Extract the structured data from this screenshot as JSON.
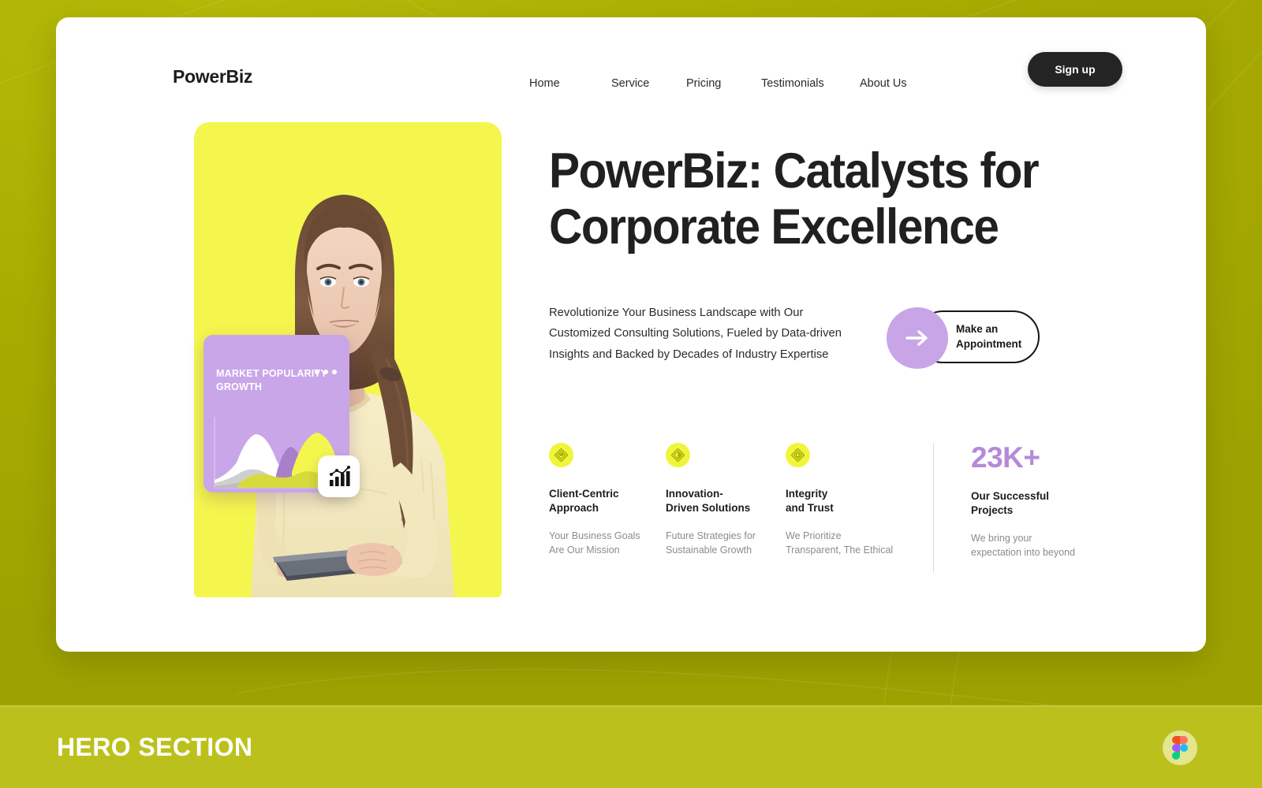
{
  "page": {
    "background_color": "#a9ad00",
    "card_background": "#ffffff"
  },
  "navbar": {
    "brand": "PowerBiz",
    "links": [
      {
        "label": "Home"
      },
      {
        "label": "Service"
      },
      {
        "label": "Pricing"
      },
      {
        "label": "Testimonials"
      },
      {
        "label": "About Us"
      }
    ],
    "signup_label": "Sign up",
    "signup_color": "#242424"
  },
  "hero": {
    "headline": "PowerBiz: Catalysts for\nCorporate Excellence",
    "subtext": "Revolutionize Your Business Landscape with Our\nCustomized Consulting Solutions, Fueled by Data-driven\nInsights and Backed by Decades of Industry Expertise",
    "cta_label": "Make an\nAppointment",
    "cta_circle_color": "#c8a5e6",
    "arrow_icon": "arrow-right-icon"
  },
  "visual": {
    "photo_background": "#f4f64e",
    "market_card": {
      "title": "MARKET\nPOPULARITY\nGROWTH",
      "background": "#c9a6e8",
      "menu_icon": "three-dots-icon"
    },
    "chart_badge_icon": "bar-chart-trend-icon"
  },
  "features": [
    {
      "icon": "diamond-badge-icon",
      "title": "Client-Centric\nApproach",
      "description": "Your Business Goals\nAre Our Mission"
    },
    {
      "icon": "diamond-badge-icon",
      "title": "Innovation-\nDriven Solutions",
      "description": "Future Strategies for\nSustainable Growth"
    },
    {
      "icon": "diamond-badge-icon",
      "title": "Integrity\nand Trust",
      "description": "We Prioritize\nTransparent, The Ethical"
    }
  ],
  "stat": {
    "number": "23K+",
    "number_color": "#b58ad8",
    "title": "Our Successful\nProjects",
    "description": "We bring your\nexpectation into beyond"
  },
  "banner": {
    "title": "HERO SECTION",
    "background": "#bcc01c",
    "logo_icon": "figma-logo-icon"
  },
  "chart_data": {
    "type": "area",
    "title": "MARKET POPULARITY GROWTH",
    "series": [
      {
        "name": "white-layer",
        "color": "#ffffff",
        "values": [
          8,
          14,
          46,
          62,
          40,
          18,
          12,
          10,
          14,
          12
        ]
      },
      {
        "name": "purple-layer",
        "color": "#a87fc9",
        "values": [
          4,
          6,
          10,
          14,
          20,
          44,
          52,
          30,
          16,
          8
        ]
      },
      {
        "name": "gray-layer",
        "color": "#cfcfcf",
        "values": [
          12,
          20,
          26,
          22,
          18,
          26,
          34,
          24,
          16,
          10
        ]
      },
      {
        "name": "yellow-layer",
        "color": "#f4f64e",
        "values": [
          6,
          8,
          12,
          16,
          22,
          34,
          56,
          70,
          46,
          20
        ]
      },
      {
        "name": "olive-layer",
        "color": "#d6da3c",
        "values": [
          10,
          16,
          22,
          30,
          36,
          30,
          40,
          48,
          34,
          18
        ]
      }
    ],
    "ylim": [
      0,
      80
    ],
    "grid": false,
    "legend": "none"
  }
}
